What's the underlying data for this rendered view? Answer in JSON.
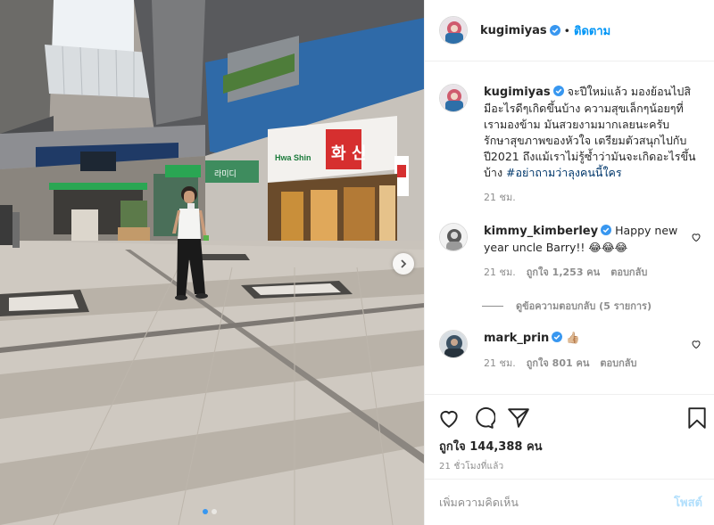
{
  "colors": {
    "accent": "#0095f6",
    "verified": "#3897f0",
    "muted": "#8e8e8e",
    "text": "#262626",
    "post_disabled": "#b2dffc",
    "border": "#efefef"
  },
  "photo": {
    "carousel_total": 2,
    "carousel_active": 1,
    "next_icon": "chevron-right-icon",
    "signs": {
      "hwa_shin_latin": "Hwa Shin",
      "hwa_shin_korean": "화 신",
      "left_sign": "라미디"
    }
  },
  "header": {
    "username": "kugimiyas",
    "verified": true,
    "separator": "•",
    "follow_label": "ติดตาม"
  },
  "caption": {
    "username": "kugimiyas",
    "verified": true,
    "text": "จะปีใหม่แล้ว มองย้อนไปสิ มีอะไรดีๆเกิดขึ้นบ้าง ความสุขเล็กๆน้อยๆที่เรามองข้าม มันสวยงามมากเลยนะครับ รักษาสุขภาพของหัวใจ เตรียมตัวสนุกไปกับปี2021 ถึงแม้เราไม่รู้ซ้ำว่ามันจะเกิดอะไรขึ้นบ้าง",
    "hashtag": "#อย่าถามว่าลุงคนนี้ใคร",
    "time": "21 ชม."
  },
  "comments": [
    {
      "username": "kimmy_kimberley",
      "verified": true,
      "text": "Happy new year uncle Barry!! 😂😂😂",
      "time": "21 ชม.",
      "likes": "ถูกใจ 1,253 คน",
      "reply_label": "ตอบกลับ"
    },
    {
      "username": "mark_prin",
      "verified": true,
      "text": "👍🏼",
      "time": "21 ชม.",
      "likes": "ถูกใจ 801 คน",
      "reply_label": "ตอบกลับ"
    }
  ],
  "view_replies": "ดูข้อความตอบกลับ (5 รายการ)",
  "actions": {
    "like_icon": "heart-icon",
    "comment_icon": "comment-icon",
    "share_icon": "share-icon",
    "save_icon": "bookmark-icon",
    "likes_count": "ถูกใจ 144,388 คน",
    "post_time": "21 ชั่วโมงที่แล้ว"
  },
  "add_comment": {
    "placeholder": "เพิ่มความคิดเห็น",
    "post_label": "โพสต์"
  }
}
